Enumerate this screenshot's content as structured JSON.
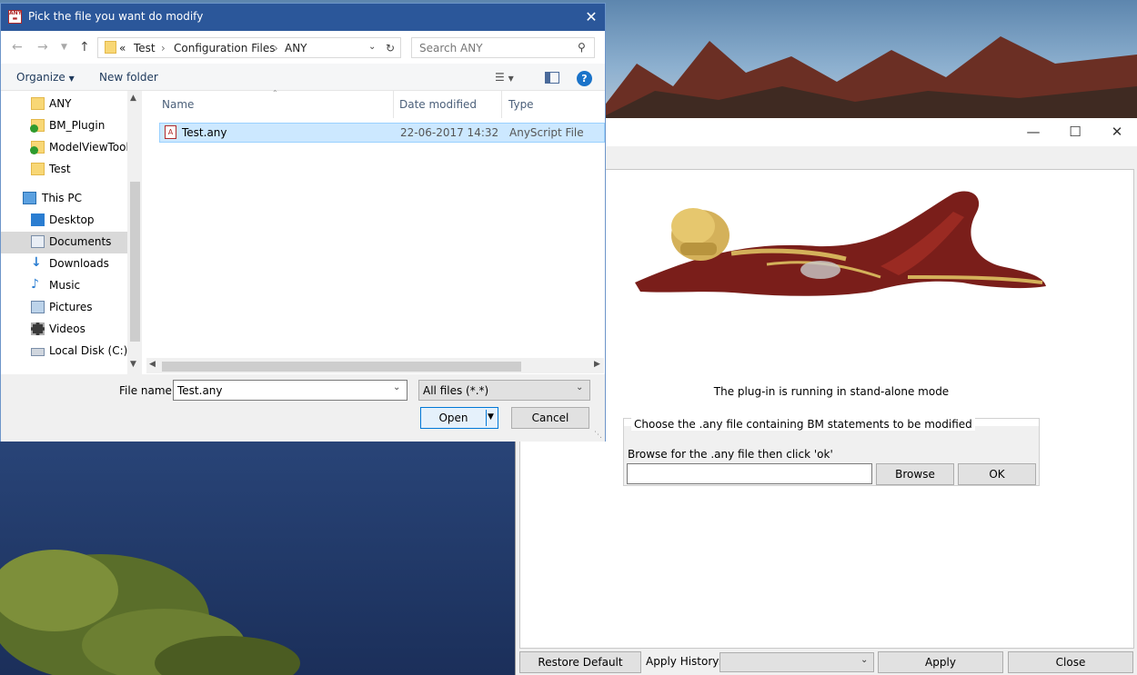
{
  "plugin": {
    "status_text": "The plug-in is running in stand-alone mode",
    "group_title": "Choose the .any file containing BM statements to be modified",
    "browse_label": "Browse for the .any file then click 'ok'",
    "path_value": "",
    "browse_button": "Browse",
    "ok_button": "OK",
    "restore_button": "Restore Default Values",
    "apply_history_label": "Apply History:",
    "apply_history_value": "",
    "apply_button": "Apply",
    "close_button": "Close"
  },
  "dialog": {
    "title": "Pick the file you want do modify",
    "breadcrumb": {
      "overflow": "«",
      "items": [
        "Test",
        "Configuration Files",
        "ANY"
      ]
    },
    "search_placeholder": "Search ANY",
    "organize_label": "Organize",
    "new_folder_label": "New folder",
    "nav_items": [
      {
        "label": "ANY",
        "icon": "folder-icon"
      },
      {
        "label": "BM_Plugin",
        "icon": "folder-synced-icon"
      },
      {
        "label": "ModelViewToolb",
        "icon": "folder-synced-icon"
      },
      {
        "label": "Test",
        "icon": "folder-icon"
      },
      {
        "label": "This PC",
        "icon": "computer-icon"
      },
      {
        "label": "Desktop",
        "icon": "desktop-icon"
      },
      {
        "label": "Documents",
        "icon": "documents-icon"
      },
      {
        "label": "Downloads",
        "icon": "downloads-icon"
      },
      {
        "label": "Music",
        "icon": "music-icon"
      },
      {
        "label": "Pictures",
        "icon": "pictures-icon"
      },
      {
        "label": "Videos",
        "icon": "videos-icon"
      },
      {
        "label": "Local Disk (C:)",
        "icon": "disk-icon"
      }
    ],
    "columns": {
      "name": "Name",
      "date": "Date modified",
      "type": "Type"
    },
    "files": [
      {
        "name": "Test.any",
        "date": "22-06-2017 14:32",
        "type": "AnyScript File"
      }
    ],
    "file_name_label": "File name:",
    "file_name_value": "Test.any",
    "filter_value": "All files (*.*)",
    "open_button": "Open",
    "cancel_button": "Cancel"
  },
  "colors": {
    "titlebar": "#2b579a",
    "selection": "#cce8ff",
    "accent": "#0078d7",
    "muscle": "#7a1e1a",
    "bone": "#d4b15a"
  }
}
